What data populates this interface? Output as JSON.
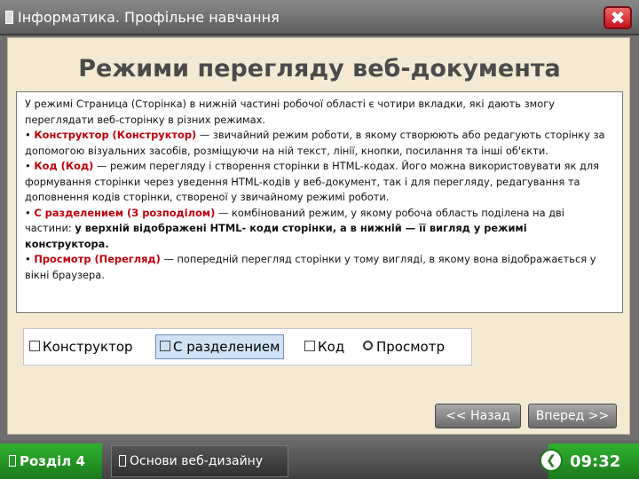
{
  "window": {
    "title": "Інформатика. Профільне навчання",
    "close_label": "✖",
    "heading": "Режими перегляду веб-документа"
  },
  "content": {
    "intro": "У режимі Страница (Сторінка) в нижній частині робочої області є чотири вкладки, які дають змогу переглядати веб-сторінку в різних режимах.",
    "items": [
      {
        "term": "Конструктор (Конструктор)",
        "desc": " — звичайний режим роботи, в якому створюють або редагують сторінку за допомогою візуальних засобів, розміщуючи на ній текст, лінії, кнопки, посилання та інші об'єкти."
      },
      {
        "term": "Код (Код)",
        "desc": " — режим перегляду і створення сторінки в HTML-кодах. Його можна використовувати як для формування сторінки через уведення HTML-кодів у веб-документ, так і для перегляду, редагування та доповнення кодів сторінки, створеної у звичайному режимі роботи."
      },
      {
        "term": "С разделением (З розподілом)",
        "desc": " — комбінований режим, у якому робоча область поділена на дві частини: ",
        "desc_bold": "у верхній відображені HTML- коди сторінки, а в нижній — її вигляд у режимі конструктора."
      },
      {
        "term": "Просмотр (Перегляд)",
        "desc": " — попередній перегляд сторінки у тому вигляді, в якому вона відображається у вікні браузера."
      }
    ]
  },
  "tabstrip": {
    "tabs": [
      {
        "label": "Конструктор",
        "icon": "design-view-icon"
      },
      {
        "label": "С разделением",
        "icon": "split-view-icon",
        "active": true
      },
      {
        "label": "Код",
        "icon": "code-view-icon"
      },
      {
        "label": "Просмотр",
        "icon": "magnifier-icon"
      }
    ]
  },
  "nav": {
    "back_label": "<< Назад",
    "forward_label": "Вперед >>"
  },
  "footer": {
    "section_label": "Розділ 4",
    "course_label": "Основи веб-дизайну",
    "time": "09:32"
  },
  "colors": {
    "panel_bg": "#f4e9d2",
    "highlight": "#c0000c",
    "green": "#2a9a2a",
    "close_red": "#d2141c"
  }
}
